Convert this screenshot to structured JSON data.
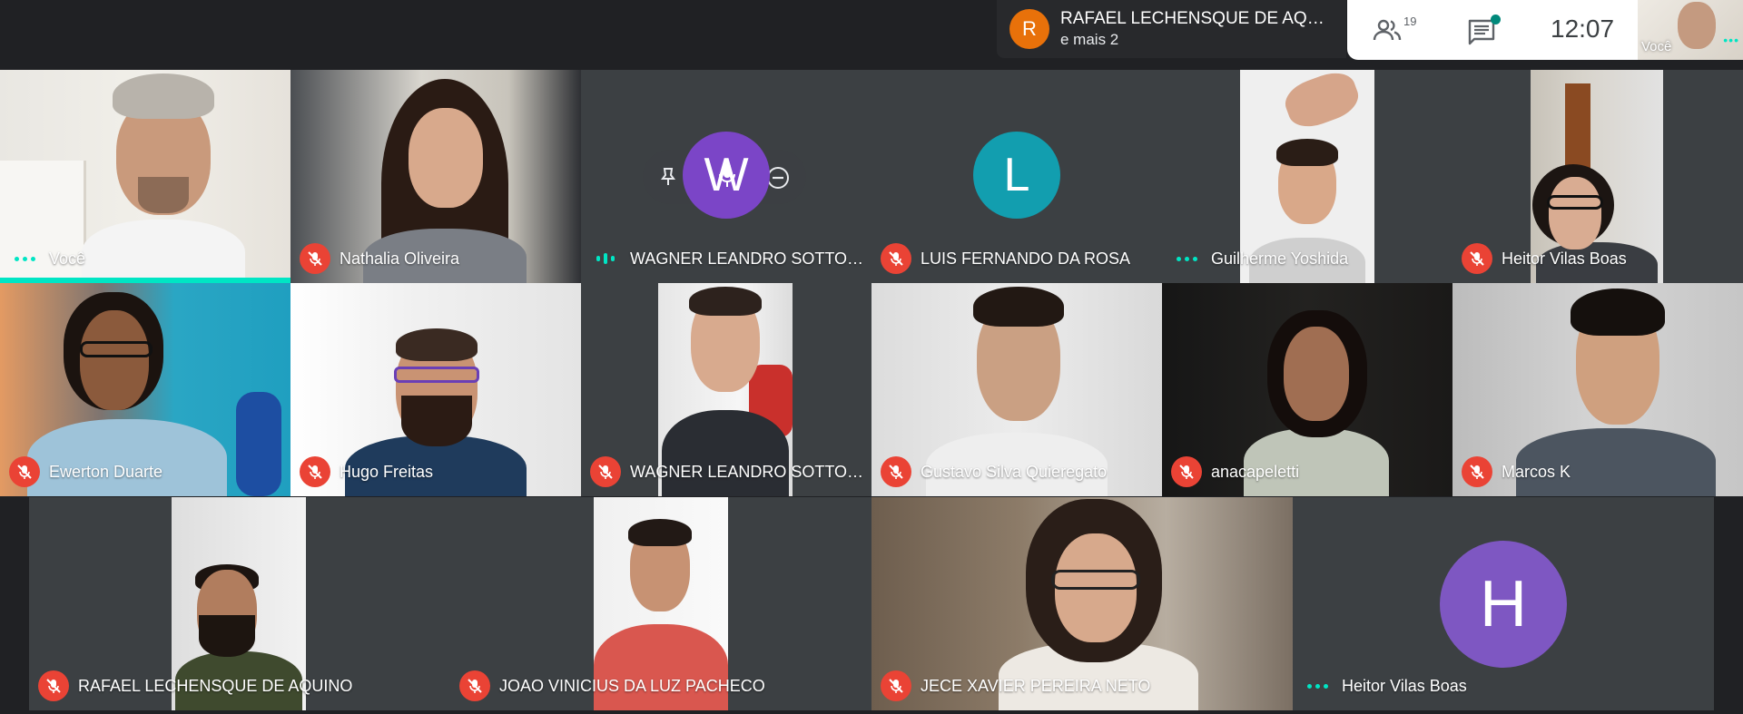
{
  "colors": {
    "background": "#202124",
    "accent_teal": "#00e5c4",
    "mic_off_red": "#ea4335",
    "avatar_orange": "#e8710a",
    "avatar_teal": "#129eaf",
    "avatar_purple": "#7e57c2"
  },
  "topbar": {
    "presenter": {
      "avatar_letter": "R",
      "name": "RAFAEL LECHENSQUE DE AQ…",
      "more": "e mais 2"
    },
    "people_count": "19",
    "people_icon": "people-icon",
    "chat_icon": "chat-icon",
    "clock": "12:07",
    "self_label": "Você"
  },
  "tiles": [
    {
      "name": "Você",
      "status": "speaking-teal"
    },
    {
      "name": "Nathalia Oliveira",
      "status": "muted"
    },
    {
      "name": "WAGNER LEANDRO SOTTO…",
      "status": "speaking-blue",
      "avatar_letter": "W"
    },
    {
      "name": "LUIS FERNANDO DA ROSA",
      "status": "muted",
      "avatar_letter": "L"
    },
    {
      "name": "Guilherme Yoshida",
      "status": "speaking-teal"
    },
    {
      "name": "Heitor Vilas Boas",
      "status": "muted"
    },
    {
      "name": "Ewerton Duarte",
      "status": "muted"
    },
    {
      "name": "Hugo Freitas",
      "status": "muted"
    },
    {
      "name": "WAGNER LEANDRO SOTTO…",
      "status": "muted"
    },
    {
      "name": "Gustavo Silva Quieregato",
      "status": "muted"
    },
    {
      "name": "anacapeletti",
      "status": "muted"
    },
    {
      "name": "Marcos K",
      "status": "muted"
    },
    {
      "name": "RAFAEL LECHENSQUE DE AQUINO",
      "status": "muted"
    },
    {
      "name": "JOAO VINICIUS DA LUZ PACHECO",
      "status": "muted"
    },
    {
      "name": "JECE XAVIER PEREIRA NETO",
      "status": "muted"
    },
    {
      "name": "Heitor Vilas Boas",
      "status": "speaking-teal",
      "avatar_letter": "H"
    }
  ]
}
